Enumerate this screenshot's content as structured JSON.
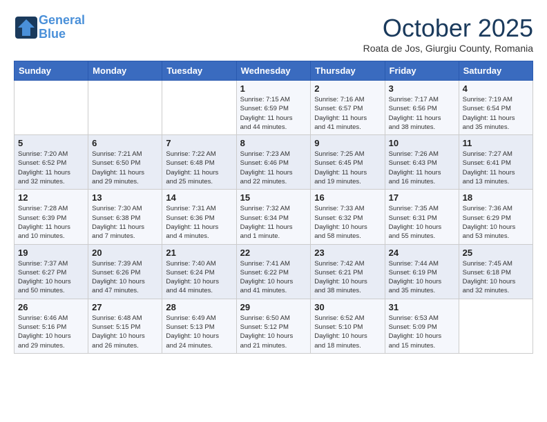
{
  "header": {
    "logo_line1": "General",
    "logo_line2": "Blue",
    "month": "October 2025",
    "location": "Roata de Jos, Giurgiu County, Romania"
  },
  "weekdays": [
    "Sunday",
    "Monday",
    "Tuesday",
    "Wednesday",
    "Thursday",
    "Friday",
    "Saturday"
  ],
  "weeks": [
    [
      {
        "day": "",
        "info": ""
      },
      {
        "day": "",
        "info": ""
      },
      {
        "day": "",
        "info": ""
      },
      {
        "day": "1",
        "info": "Sunrise: 7:15 AM\nSunset: 6:59 PM\nDaylight: 11 hours\nand 44 minutes."
      },
      {
        "day": "2",
        "info": "Sunrise: 7:16 AM\nSunset: 6:57 PM\nDaylight: 11 hours\nand 41 minutes."
      },
      {
        "day": "3",
        "info": "Sunrise: 7:17 AM\nSunset: 6:56 PM\nDaylight: 11 hours\nand 38 minutes."
      },
      {
        "day": "4",
        "info": "Sunrise: 7:19 AM\nSunset: 6:54 PM\nDaylight: 11 hours\nand 35 minutes."
      }
    ],
    [
      {
        "day": "5",
        "info": "Sunrise: 7:20 AM\nSunset: 6:52 PM\nDaylight: 11 hours\nand 32 minutes."
      },
      {
        "day": "6",
        "info": "Sunrise: 7:21 AM\nSunset: 6:50 PM\nDaylight: 11 hours\nand 29 minutes."
      },
      {
        "day": "7",
        "info": "Sunrise: 7:22 AM\nSunset: 6:48 PM\nDaylight: 11 hours\nand 25 minutes."
      },
      {
        "day": "8",
        "info": "Sunrise: 7:23 AM\nSunset: 6:46 PM\nDaylight: 11 hours\nand 22 minutes."
      },
      {
        "day": "9",
        "info": "Sunrise: 7:25 AM\nSunset: 6:45 PM\nDaylight: 11 hours\nand 19 minutes."
      },
      {
        "day": "10",
        "info": "Sunrise: 7:26 AM\nSunset: 6:43 PM\nDaylight: 11 hours\nand 16 minutes."
      },
      {
        "day": "11",
        "info": "Sunrise: 7:27 AM\nSunset: 6:41 PM\nDaylight: 11 hours\nand 13 minutes."
      }
    ],
    [
      {
        "day": "12",
        "info": "Sunrise: 7:28 AM\nSunset: 6:39 PM\nDaylight: 11 hours\nand 10 minutes."
      },
      {
        "day": "13",
        "info": "Sunrise: 7:30 AM\nSunset: 6:38 PM\nDaylight: 11 hours\nand 7 minutes."
      },
      {
        "day": "14",
        "info": "Sunrise: 7:31 AM\nSunset: 6:36 PM\nDaylight: 11 hours\nand 4 minutes."
      },
      {
        "day": "15",
        "info": "Sunrise: 7:32 AM\nSunset: 6:34 PM\nDaylight: 11 hours\nand 1 minute."
      },
      {
        "day": "16",
        "info": "Sunrise: 7:33 AM\nSunset: 6:32 PM\nDaylight: 10 hours\nand 58 minutes."
      },
      {
        "day": "17",
        "info": "Sunrise: 7:35 AM\nSunset: 6:31 PM\nDaylight: 10 hours\nand 55 minutes."
      },
      {
        "day": "18",
        "info": "Sunrise: 7:36 AM\nSunset: 6:29 PM\nDaylight: 10 hours\nand 53 minutes."
      }
    ],
    [
      {
        "day": "19",
        "info": "Sunrise: 7:37 AM\nSunset: 6:27 PM\nDaylight: 10 hours\nand 50 minutes."
      },
      {
        "day": "20",
        "info": "Sunrise: 7:39 AM\nSunset: 6:26 PM\nDaylight: 10 hours\nand 47 minutes."
      },
      {
        "day": "21",
        "info": "Sunrise: 7:40 AM\nSunset: 6:24 PM\nDaylight: 10 hours\nand 44 minutes."
      },
      {
        "day": "22",
        "info": "Sunrise: 7:41 AM\nSunset: 6:22 PM\nDaylight: 10 hours\nand 41 minutes."
      },
      {
        "day": "23",
        "info": "Sunrise: 7:42 AM\nSunset: 6:21 PM\nDaylight: 10 hours\nand 38 minutes."
      },
      {
        "day": "24",
        "info": "Sunrise: 7:44 AM\nSunset: 6:19 PM\nDaylight: 10 hours\nand 35 minutes."
      },
      {
        "day": "25",
        "info": "Sunrise: 7:45 AM\nSunset: 6:18 PM\nDaylight: 10 hours\nand 32 minutes."
      }
    ],
    [
      {
        "day": "26",
        "info": "Sunrise: 6:46 AM\nSunset: 5:16 PM\nDaylight: 10 hours\nand 29 minutes."
      },
      {
        "day": "27",
        "info": "Sunrise: 6:48 AM\nSunset: 5:15 PM\nDaylight: 10 hours\nand 26 minutes."
      },
      {
        "day": "28",
        "info": "Sunrise: 6:49 AM\nSunset: 5:13 PM\nDaylight: 10 hours\nand 24 minutes."
      },
      {
        "day": "29",
        "info": "Sunrise: 6:50 AM\nSunset: 5:12 PM\nDaylight: 10 hours\nand 21 minutes."
      },
      {
        "day": "30",
        "info": "Sunrise: 6:52 AM\nSunset: 5:10 PM\nDaylight: 10 hours\nand 18 minutes."
      },
      {
        "day": "31",
        "info": "Sunrise: 6:53 AM\nSunset: 5:09 PM\nDaylight: 10 hours\nand 15 minutes."
      },
      {
        "day": "",
        "info": ""
      }
    ]
  ]
}
